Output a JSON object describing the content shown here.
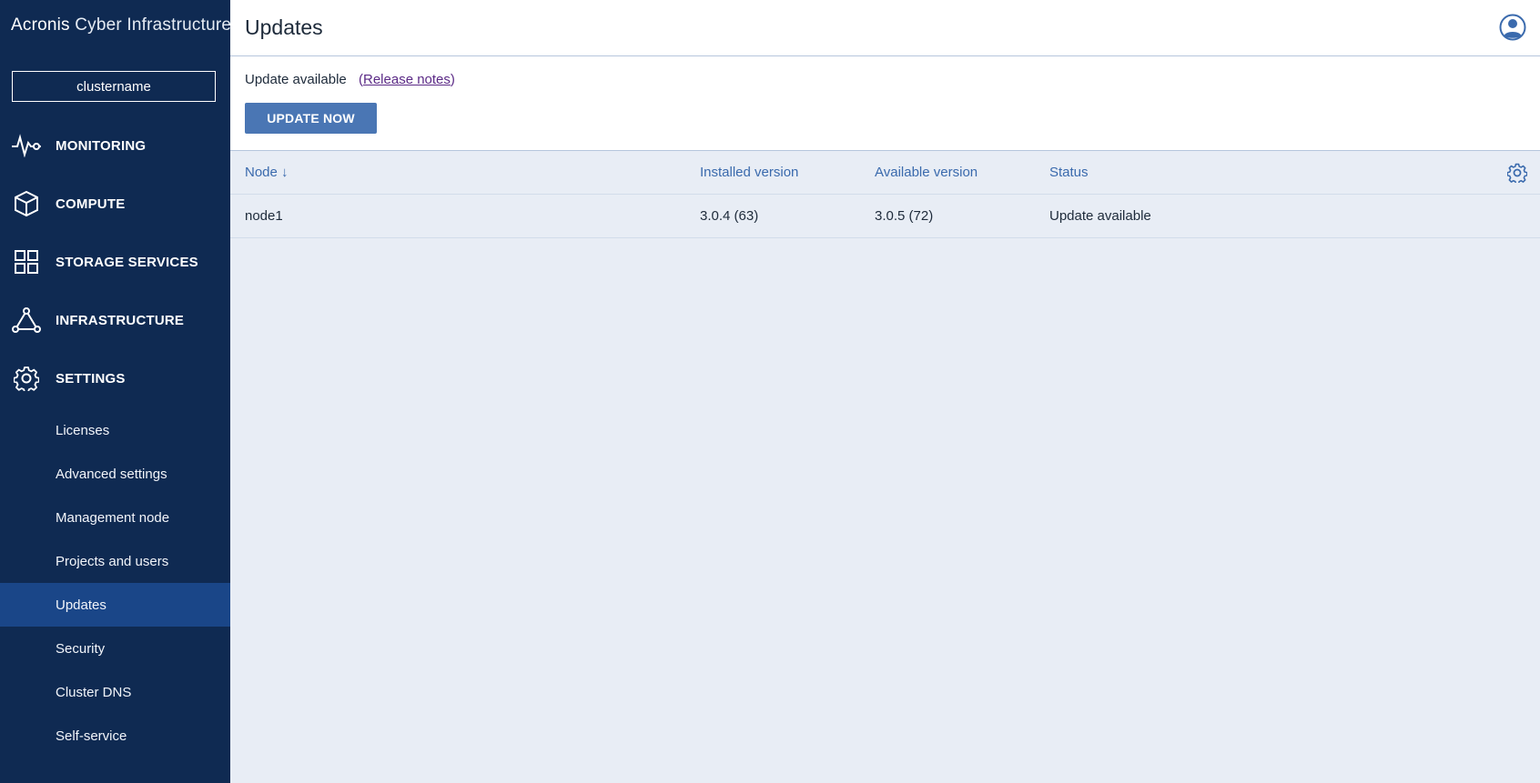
{
  "app": {
    "brand_primary": "Acronis",
    "brand_secondary": "Cyber Infrastructure",
    "cluster_name": "clustername"
  },
  "sidebar": {
    "main_items": [
      {
        "label": "MONITORING",
        "icon": "pulse-icon"
      },
      {
        "label": "COMPUTE",
        "icon": "cube-icon"
      },
      {
        "label": "STORAGE SERVICES",
        "icon": "grid-icon"
      },
      {
        "label": "INFRASTRUCTURE",
        "icon": "network-triangle-icon"
      },
      {
        "label": "SETTINGS",
        "icon": "gear-icon"
      }
    ],
    "settings_items": [
      {
        "label": "Licenses"
      },
      {
        "label": "Advanced settings"
      },
      {
        "label": "Management node"
      },
      {
        "label": "Projects and users"
      },
      {
        "label": "Updates",
        "active": true
      },
      {
        "label": "Security"
      },
      {
        "label": "Cluster DNS"
      },
      {
        "label": "Self-service"
      }
    ]
  },
  "header": {
    "title": "Updates"
  },
  "update_panel": {
    "status_text": "Update available",
    "release_prefix": "(",
    "release_link": "Release notes",
    "release_suffix": ")",
    "button_label": "UPDATE NOW"
  },
  "table": {
    "columns": [
      "Node",
      "Installed version",
      "Available version",
      "Status"
    ],
    "sort_indicator": "↓",
    "rows": [
      {
        "node": "node1",
        "installed": "3.0.4 (63)",
        "available": "3.0.5 (72)",
        "status": "Update available"
      }
    ]
  },
  "colors": {
    "sidebar_bg": "#0f2a52",
    "sidebar_active": "#1a4688",
    "accent": "#4a76b4",
    "link": "#5b2a86",
    "content_bg": "#e8edf5"
  }
}
